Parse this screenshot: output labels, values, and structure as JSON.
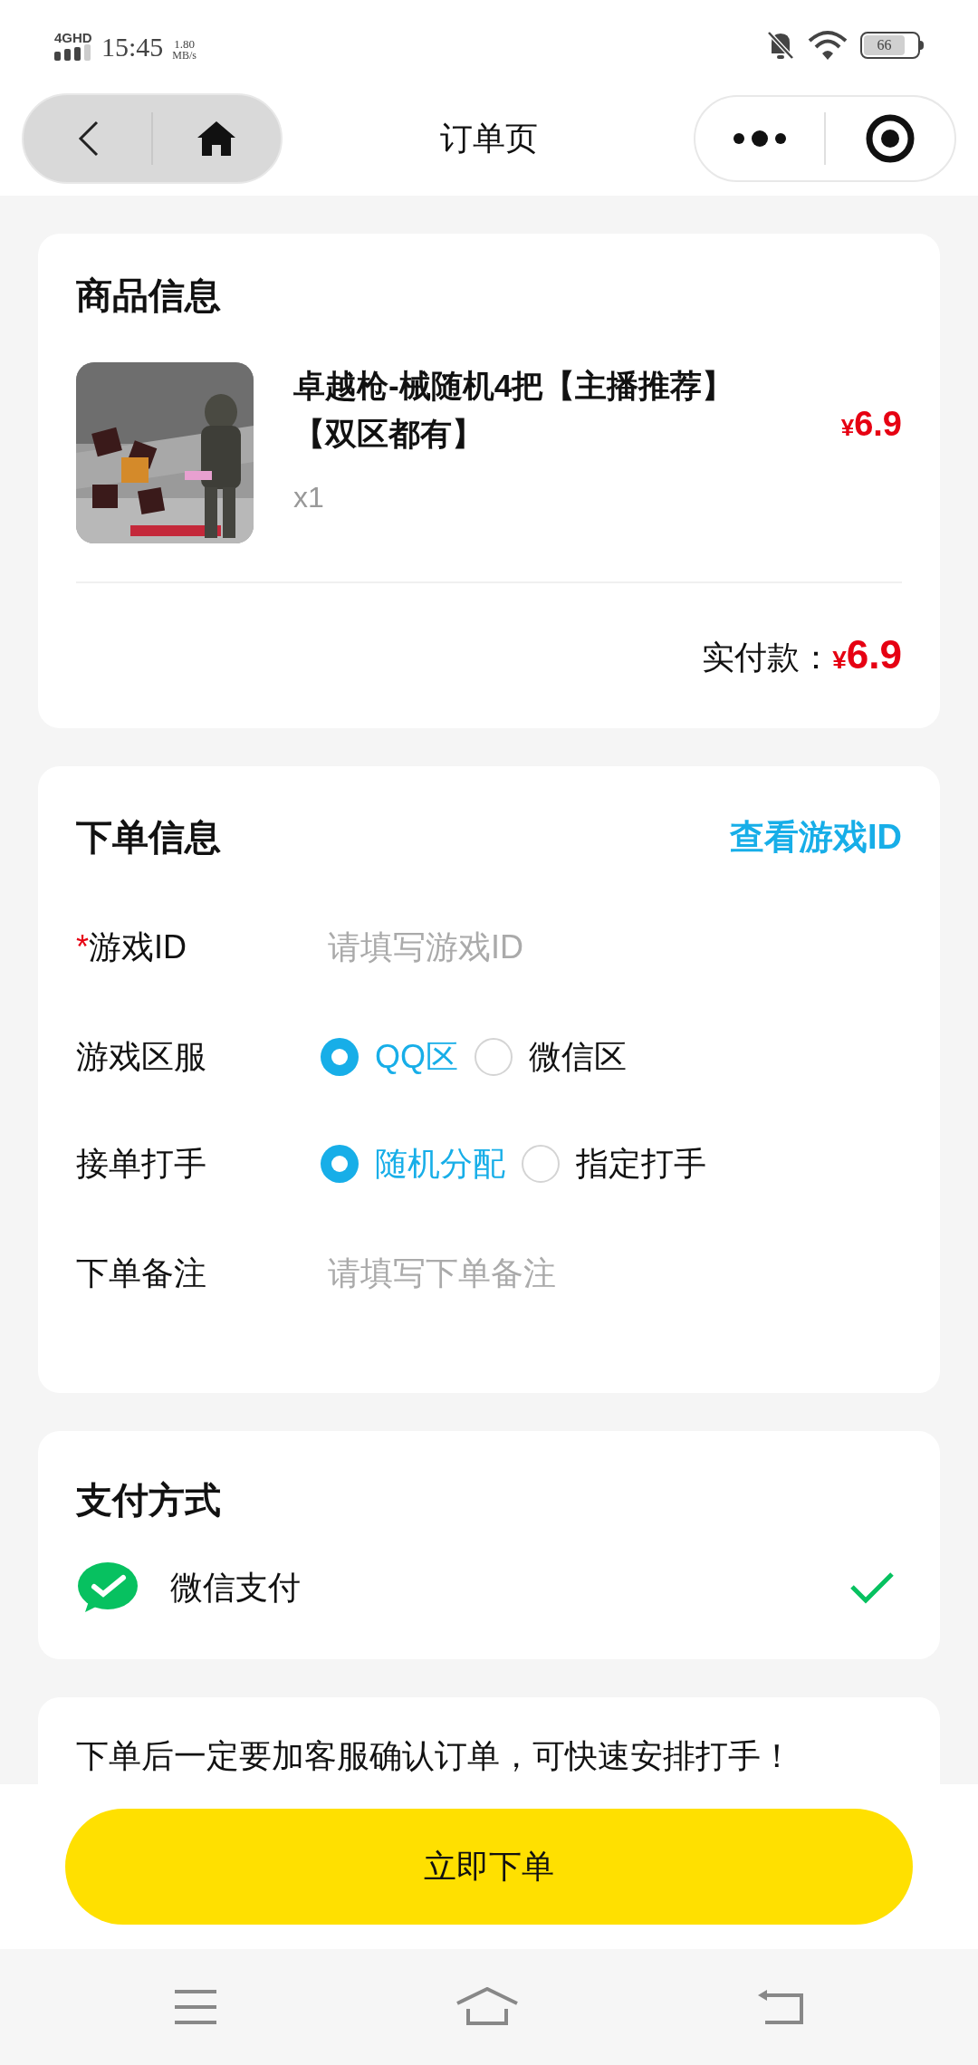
{
  "status_bar": {
    "network": "4GHD",
    "time": "15:45",
    "speed": "1.80",
    "speed_unit": "MB/s",
    "battery": "66"
  },
  "nav": {
    "title": "订单页"
  },
  "product_card": {
    "title": "商品信息",
    "item": {
      "name": "卓越枪-械随机4把【主播推荐】【双区都有】",
      "quantity": "x1",
      "price_symbol": "¥",
      "price": "6.9"
    },
    "total_label": "实付款：",
    "total_symbol": "¥",
    "total": "6.9"
  },
  "order_info": {
    "title": "下单信息",
    "link": "查看游戏ID",
    "fields": [
      {
        "kind": "input",
        "required_mark": "*",
        "label": "游戏ID",
        "placeholder": "请填写游戏ID"
      },
      {
        "kind": "radio",
        "label": "游戏区服",
        "options": [
          {
            "label": "QQ区",
            "selected": true
          },
          {
            "label": "微信区",
            "selected": false
          }
        ]
      },
      {
        "kind": "radio",
        "label": "接单打手",
        "options": [
          {
            "label": "随机分配",
            "selected": true
          },
          {
            "label": "指定打手",
            "selected": false
          }
        ]
      },
      {
        "kind": "input",
        "label": "下单备注",
        "placeholder": "请填写下单备注"
      }
    ]
  },
  "payment": {
    "title": "支付方式",
    "methods": [
      {
        "label": "微信支付",
        "selected": true
      }
    ]
  },
  "notice": {
    "text": "下单后一定要加客服确认订单，可快速安排打手！"
  },
  "submit": {
    "label": "立即下单"
  }
}
